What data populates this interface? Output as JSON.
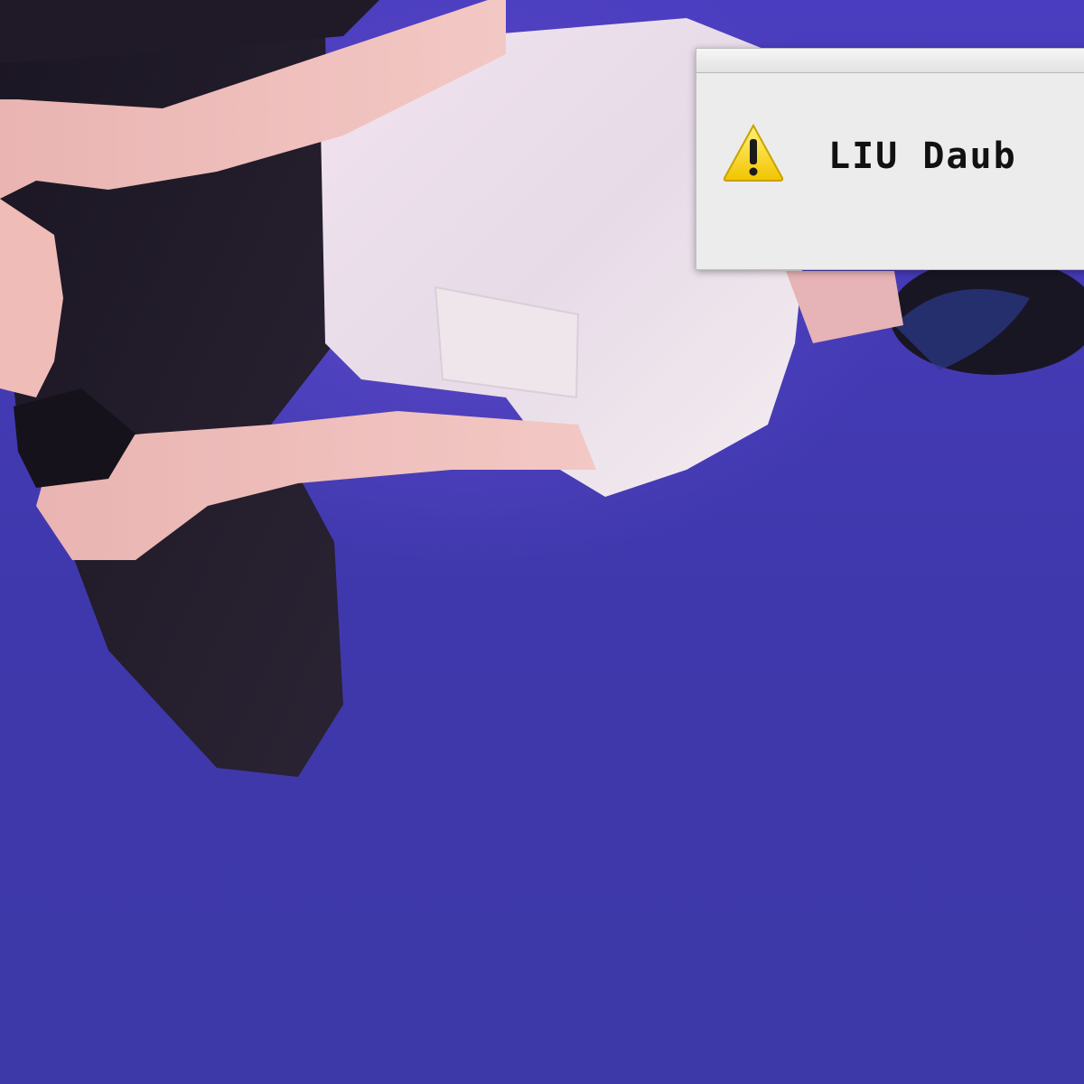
{
  "background": {
    "color": "#4238b0",
    "subject": "photo-person-inverted"
  },
  "dialog": {
    "icon": "warning-icon",
    "icon_color": "#f7d21f",
    "message": "LIU Daub"
  }
}
